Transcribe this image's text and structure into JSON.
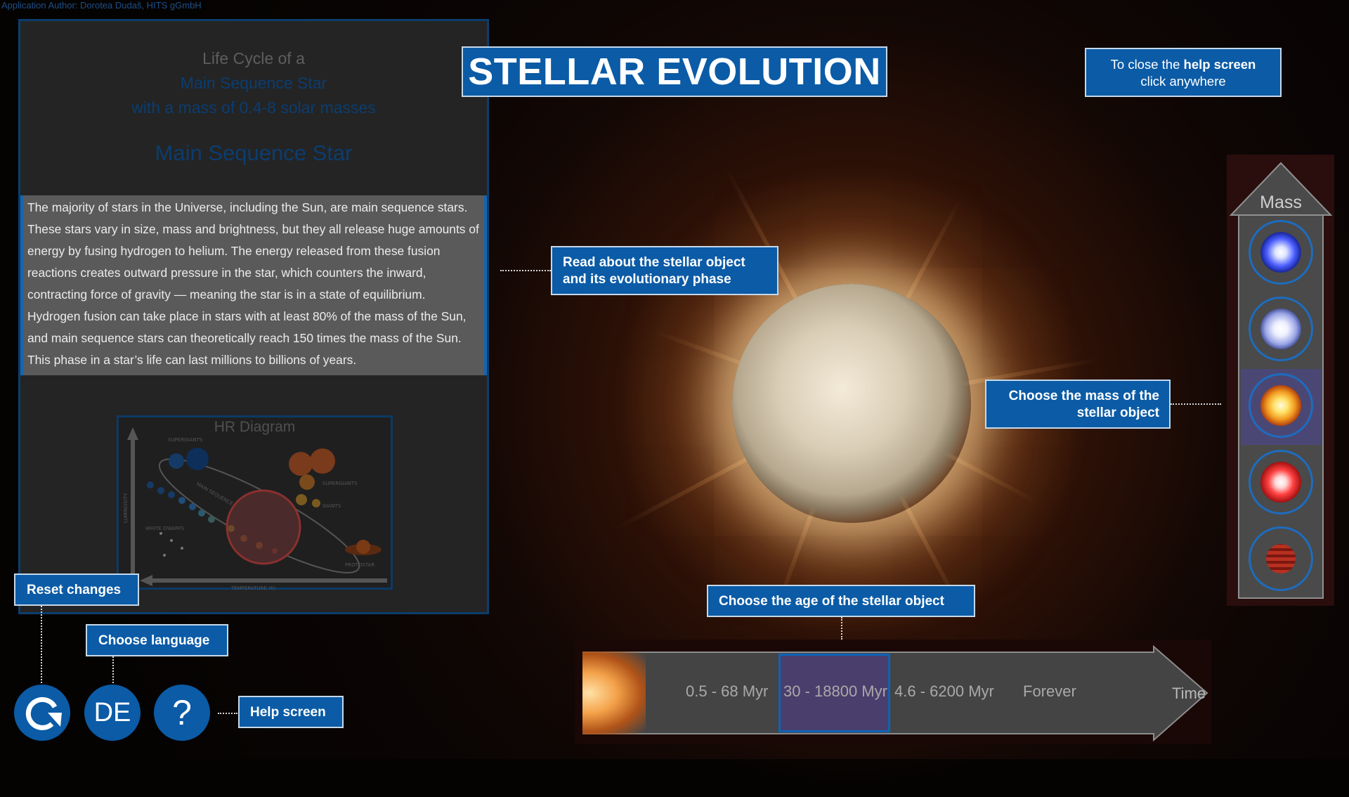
{
  "attribution": "Application Author: Dorotea Dudaš, HITS gGmbH",
  "title": "STELLAR EVOLUTION",
  "help_close": {
    "line1_a": "To close the ",
    "line1_b": "help screen",
    "line2": "click anywhere"
  },
  "info_panel": {
    "line1": "Life Cycle of a",
    "line2": "Main Sequence Star",
    "line3": "with a mass of 0.4-8 solar masses",
    "phase_title": "Main Sequence Star",
    "description": "The majority of stars in the Universe, including the Sun, are main sequence stars. These stars vary in size, mass and brightness, but they all release huge amounts of energy by fusing hydrogen to helium. The energy released from these fusion reactions creates outward pressure in the star, which counters the inward, contracting force of gravity — meaning the star is in a state of equilibrium. Hydrogen fusion can take place in stars with at least 80% of the mass of the Sun, and main sequence stars can theoretically reach 150 times the mass of the Sun. This phase in a star’s life can last millions to billions of years.",
    "hr_diagram": {
      "title": "HR Diagram",
      "labels": {
        "supergiants_top": "SUPERGIANTS",
        "supergiants": "SUPERGIANTS",
        "giants": "GIANTS",
        "main_sequence": "MAIN SEQUENCE",
        "white_dwarfs": "WHITE DWARFS",
        "protostar": "PROTOSTAR",
        "luminosity": "LUMINOSITY",
        "temperature": "TEMPERATURE (K)"
      }
    }
  },
  "tooltips": {
    "read": [
      "Read about the stellar object",
      "and its evolutionary phase"
    ],
    "mass": [
      "Choose the mass of the",
      "stellar object"
    ],
    "age": "Choose the age of the stellar object",
    "reset": "Reset changes",
    "language": "Choose language",
    "help": "Help screen"
  },
  "mass_selector": {
    "label": "Mass",
    "selected_index": 2,
    "options": [
      {
        "icon": "blue-star-icon",
        "color": "#3a5cff"
      },
      {
        "icon": "white-blue-star-icon",
        "color": "#b8c4ff"
      },
      {
        "icon": "yellow-star-icon",
        "color": "#ffd24a"
      },
      {
        "icon": "red-star-icon",
        "color": "#ff3a3a"
      },
      {
        "icon": "brown-dwarf-icon",
        "color": "#a8241a"
      }
    ]
  },
  "timeline": {
    "label": "Time",
    "ages": [
      "0.5 - 68 Myr",
      "30 - 18800 Myr",
      "4.6 - 6200 Myr",
      "Forever"
    ],
    "selected_index": 1
  },
  "buttons": {
    "reset_icon": "refresh-icon",
    "language": "DE",
    "help": "?"
  },
  "colors": {
    "accent": "#0b5ba6",
    "selection": "#4a3e6c",
    "panel": "#242424"
  }
}
